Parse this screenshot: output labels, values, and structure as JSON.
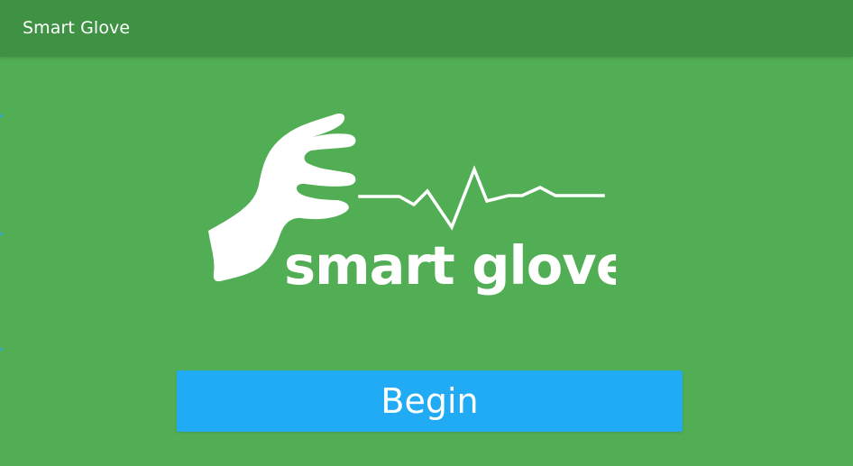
{
  "app": {
    "title": "Smart Glove",
    "background_color": "#52ae54",
    "app_bar_color": "#3f9244",
    "accent_color": "#21abf4"
  },
  "logo": {
    "wordmark": "smart glove",
    "icon": "hand-sensor-pulse-icon"
  },
  "actions": {
    "begin_label": "Begin"
  }
}
